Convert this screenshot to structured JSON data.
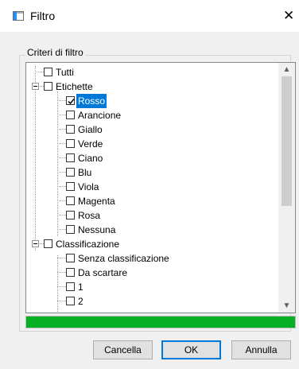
{
  "window": {
    "title": "Filtro",
    "close_glyph": "✕"
  },
  "group": {
    "label": "Criteri di filtro"
  },
  "tree": {
    "items": [
      {
        "label": "Tutti",
        "checked": false
      },
      {
        "label": "Etichette",
        "checked": false,
        "expanded": true
      },
      {
        "label": "Rosso",
        "checked": true,
        "selected": true
      },
      {
        "label": "Arancione",
        "checked": false
      },
      {
        "label": "Giallo",
        "checked": false
      },
      {
        "label": "Verde",
        "checked": false
      },
      {
        "label": "Ciano",
        "checked": false
      },
      {
        "label": "Blu",
        "checked": false
      },
      {
        "label": "Viola",
        "checked": false
      },
      {
        "label": "Magenta",
        "checked": false
      },
      {
        "label": "Rosa",
        "checked": false
      },
      {
        "label": "Nessuna",
        "checked": false
      },
      {
        "label": "Classificazione",
        "checked": false,
        "expanded": true
      },
      {
        "label": "Senza classificazione",
        "checked": false
      },
      {
        "label": "Da scartare",
        "checked": false
      },
      {
        "label": "1",
        "checked": false
      },
      {
        "label": "2",
        "checked": false
      }
    ]
  },
  "scrollbar": {
    "up_glyph": "▲",
    "down_glyph": "▼"
  },
  "progress": {
    "value": 1.0,
    "color": "#06b025"
  },
  "buttons": {
    "cancel": "Cancella",
    "ok": "OK",
    "annulla": "Annulla"
  },
  "colors": {
    "selection": "#0078d7"
  }
}
